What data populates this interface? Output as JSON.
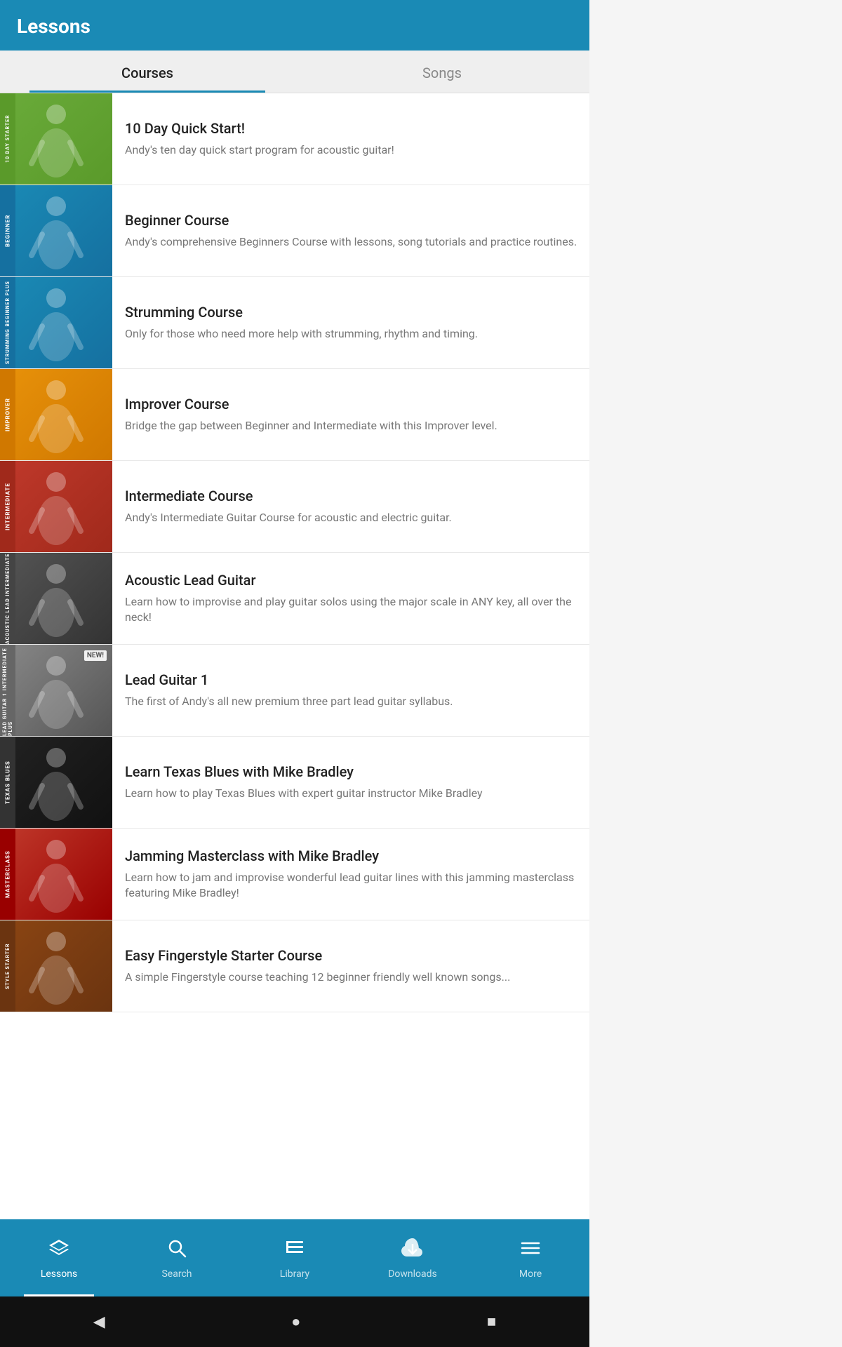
{
  "header": {
    "title": "Lessons"
  },
  "tabs": [
    {
      "id": "courses",
      "label": "Courses",
      "active": true
    },
    {
      "id": "songs",
      "label": "Songs",
      "active": false
    }
  ],
  "courses": [
    {
      "id": "10day",
      "title": "10 Day Quick Start!",
      "desc": "Andy's ten day quick start program for acoustic guitar!",
      "badge": "10 DAY STARTER",
      "badgeClass": "badge-10day",
      "thumbClass": "thumb-10day",
      "isNew": false
    },
    {
      "id": "beginner",
      "title": "Beginner Course",
      "desc": "Andy's comprehensive Beginners Course with lessons, song tutorials and practice routines.",
      "badge": "BEGINNER",
      "badgeClass": "badge-beginner",
      "thumbClass": "thumb-beginner",
      "isNew": false
    },
    {
      "id": "strumming",
      "title": "Strumming Course",
      "desc": "Only for those who need more help with strumming, rhythm and timing.",
      "badge": "STRUMMING BEGINNER PLUS",
      "badgeClass": "badge-strumming",
      "thumbClass": "thumb-strumming",
      "isNew": false
    },
    {
      "id": "improver",
      "title": "Improver Course",
      "desc": "Bridge the gap between Beginner and Intermediate with this Improver level.",
      "badge": "IMPROVER",
      "badgeClass": "badge-improver",
      "thumbClass": "thumb-improver",
      "isNew": false
    },
    {
      "id": "intermediate",
      "title": "Intermediate Course",
      "desc": "Andy's Intermediate Guitar Course for acoustic and electric guitar.",
      "badge": "INTERMEDIATE",
      "badgeClass": "badge-intermediate",
      "thumbClass": "thumb-intermediate",
      "isNew": false
    },
    {
      "id": "acoustic",
      "title": "Acoustic Lead Guitar",
      "desc": "Learn how to improvise and play guitar solos using the major scale in ANY key, all over the neck!",
      "badge": "ACOUSTIC LEAD INTERMEDIATE",
      "badgeClass": "badge-acoustic",
      "thumbClass": "thumb-acoustic",
      "isNew": false
    },
    {
      "id": "lead",
      "title": "Lead Guitar 1",
      "desc": "The first of Andy's all new premium three part lead guitar syllabus.",
      "badge": "LEAD GUITAR 1 INTERMEDIATE PLUS",
      "badgeClass": "badge-lead",
      "thumbClass": "thumb-lead",
      "isNew": true,
      "newLabel": "NEW!"
    },
    {
      "id": "blues",
      "title": "Learn Texas Blues with Mike Bradley",
      "desc": "Learn how to play Texas Blues with expert guitar instructor Mike Bradley",
      "badge": "TEXAS BLUES",
      "badgeClass": "badge-blues",
      "thumbClass": "thumb-blues",
      "isNew": false
    },
    {
      "id": "jamming",
      "title": "Jamming Masterclass with Mike Bradley",
      "desc": "Learn how to jam and improvise wonderful lead guitar lines with this jamming masterclass featuring Mike Bradley!",
      "badge": "MASTERCLASS",
      "badgeClass": "badge-jamming",
      "thumbClass": "thumb-jamming",
      "isNew": false
    },
    {
      "id": "fingerstyle",
      "title": "Easy Fingerstyle Starter Course",
      "desc": "A simple Fingerstyle course teaching 12 beginner friendly well known songs...",
      "badge": "STYLE STARTER",
      "badgeClass": "badge-fingerstyle",
      "thumbClass": "thumb-fingerstyle",
      "isNew": false
    }
  ],
  "bottomNav": [
    {
      "id": "lessons",
      "label": "Lessons",
      "icon": "🎓",
      "active": true
    },
    {
      "id": "search",
      "label": "Search",
      "icon": "🔍",
      "active": false
    },
    {
      "id": "library",
      "label": "Library",
      "icon": "▶",
      "active": false
    },
    {
      "id": "downloads",
      "label": "Downloads",
      "icon": "⬇",
      "active": false
    },
    {
      "id": "more",
      "label": "More",
      "icon": "☰",
      "active": false
    }
  ],
  "androidNav": {
    "back": "◀",
    "home": "●",
    "recent": "■"
  }
}
